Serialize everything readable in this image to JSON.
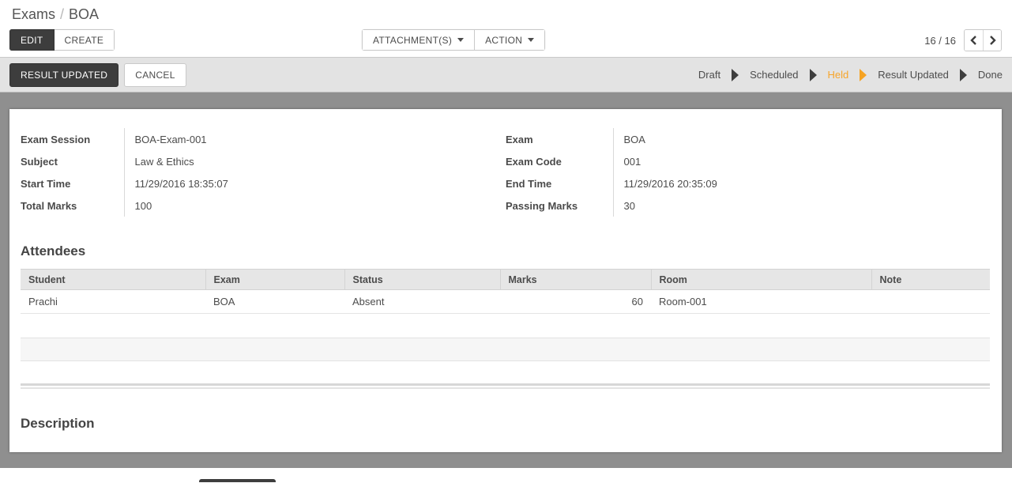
{
  "colors": {
    "accent_orange": "#f7a52a",
    "dark_button": "#3d3d3d",
    "page_background_gray": "#8f8f8f",
    "statusbar_gray": "#e3e3e3"
  },
  "breadcrumb": {
    "parent": "Exams",
    "separator": "/",
    "current": "BOA"
  },
  "header": {
    "edit_label": "EDIT",
    "create_label": "CREATE",
    "attachments_label": "ATTACHMENT(S)",
    "action_label": "ACTION",
    "pager_text": "16 / 16"
  },
  "statusbar": {
    "result_updated_label": "RESULT UPDATED",
    "cancel_label": "CANCEL",
    "stages": [
      {
        "label": "Draft",
        "active": false
      },
      {
        "label": "Scheduled",
        "active": false
      },
      {
        "label": "Held",
        "active": true
      },
      {
        "label": "Result Updated",
        "active": false
      },
      {
        "label": "Done",
        "active": false
      }
    ]
  },
  "form": {
    "left_fields": [
      {
        "label": "Exam Session",
        "value": "BOA-Exam-001"
      },
      {
        "label": "Subject",
        "value": "Law & Ethics"
      },
      {
        "label": "Start Time",
        "value": "11/29/2016 18:35:07"
      },
      {
        "label": "Total Marks",
        "value": "100"
      }
    ],
    "right_fields": [
      {
        "label": "Exam",
        "value": "BOA"
      },
      {
        "label": "Exam Code",
        "value": "001"
      },
      {
        "label": "End Time",
        "value": "11/29/2016 20:35:09"
      },
      {
        "label": "Passing Marks",
        "value": "30"
      }
    ]
  },
  "attendees": {
    "title": "Attendees",
    "columns": [
      "Student",
      "Exam",
      "Status",
      "Marks",
      "Room",
      "Note"
    ],
    "rows": [
      [
        "Prachi",
        "BOA",
        "Absent",
        "60",
        "Room-001",
        ""
      ]
    ]
  },
  "description": {
    "title": "Description"
  }
}
